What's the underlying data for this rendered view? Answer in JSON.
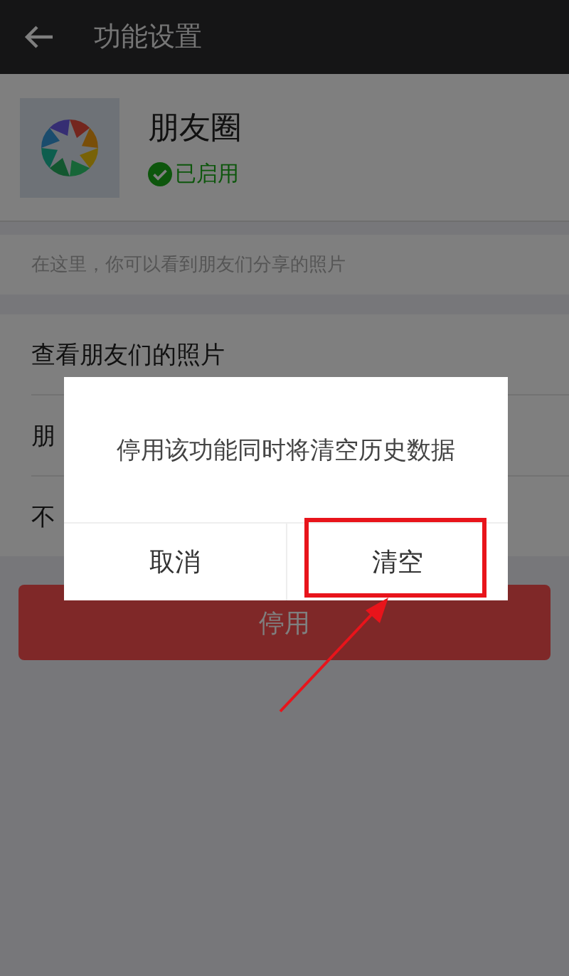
{
  "top_bar": {
    "title": "功能设置"
  },
  "feature": {
    "name": "朋友圈",
    "status": "已启用",
    "enabled": true
  },
  "description": "在这里，你可以看到朋友们分享的照片",
  "settings_rows": [
    {
      "label": "查看朋友们的照片"
    },
    {
      "label": "朋"
    },
    {
      "label": "不"
    }
  ],
  "disable_button": {
    "label": "停用"
  },
  "dialog": {
    "message": "停用该功能同时将清空历史数据",
    "buttons": [
      {
        "label": "取消",
        "highlighted": false
      },
      {
        "label": "清空",
        "highlighted": true
      }
    ]
  }
}
